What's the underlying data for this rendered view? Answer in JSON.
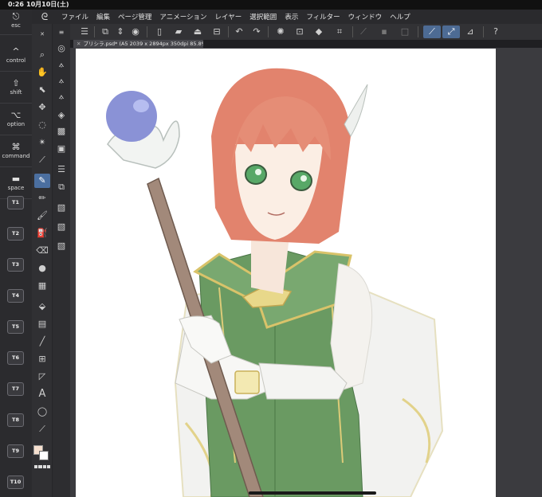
{
  "status_bar": {
    "time": "0:26",
    "date": "10月10日(土)"
  },
  "menu": {
    "app_icon": "app-logo-icon",
    "items": [
      "ファイル",
      "編集",
      "ページ管理",
      "アニメーション",
      "レイヤー",
      "選択範囲",
      "表示",
      "フィルター",
      "ウィンドウ",
      "ヘルプ"
    ]
  },
  "shortcut_keys": [
    {
      "icon": "⎋",
      "label": "esc"
    },
    {
      "icon": "^",
      "label": "control"
    },
    {
      "icon": "⇧",
      "label": "shift"
    },
    {
      "icon": "⌥",
      "label": "option"
    },
    {
      "icon": "⌘",
      "label": "command"
    },
    {
      "icon": "▬",
      "label": "space"
    }
  ],
  "custom_keys": [
    "T1",
    "T2",
    "T3",
    "T4",
    "T5",
    "T6",
    "T7",
    "T8",
    "T9",
    "T10"
  ],
  "document_tab": {
    "label": "プリシラ.psd* (A5 2039 x 2894px 350dpi 85.8%)"
  },
  "colors": {
    "main_color": "#f6e0cf",
    "sub_color": "#ffffff",
    "accent": "#4b6fa0"
  }
}
